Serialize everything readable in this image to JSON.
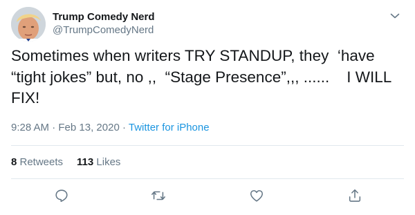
{
  "author": {
    "display_name": "Trump Comedy Nerd",
    "handle": "@TrumpComedyNerd"
  },
  "tweet": {
    "text_line1": "Sometimes when writers TRY STANDUP, they  ‘have",
    "text_line2": "“tight jokes” but, no ,,  “Stage Presence”,,, ......    I WILL",
    "text_line3": "FIX!",
    "time": "9:28 AM",
    "date": "Feb 13, 2020",
    "separator": " · ",
    "source": "Twitter for iPhone"
  },
  "stats": {
    "retweets_count": "8",
    "retweets_label": " Retweets",
    "likes_count": "113",
    "likes_label": " Likes"
  },
  "icons": {
    "caret": "chevron-down-icon",
    "reply": "reply-icon",
    "retweet": "retweet-icon",
    "like": "heart-icon",
    "share": "share-icon"
  },
  "colors": {
    "text": "#14171a",
    "secondary": "#657786",
    "link": "#1b95e0",
    "divider": "#e1e8ed"
  }
}
